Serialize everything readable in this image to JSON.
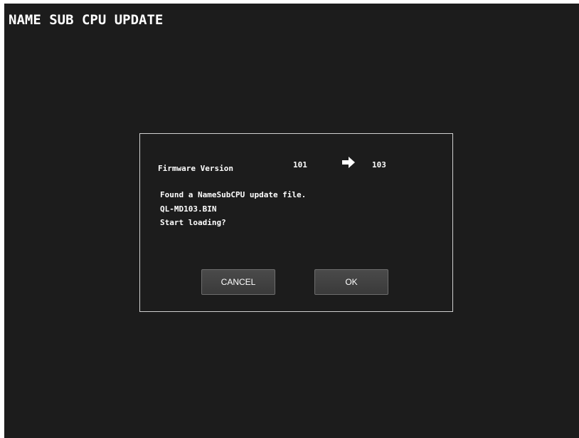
{
  "screen": {
    "title": "NAME SUB CPU UPDATE"
  },
  "dialog": {
    "firmware_label": "Firmware Version",
    "current_version": "101",
    "arrow_icon": "right-arrow-icon",
    "new_version": "103",
    "message_lines": [
      "Found a NameSubCPU update file.",
      "QL-MD103.BIN",
      "Start loading?"
    ],
    "cancel_label": "CANCEL",
    "ok_label": "OK"
  },
  "colors": {
    "background": "#1c1c1c",
    "text": "#ffffff",
    "dialog_border": "#d0d0d0",
    "button_fill": "#424242",
    "button_border": "#6e6e6e"
  }
}
